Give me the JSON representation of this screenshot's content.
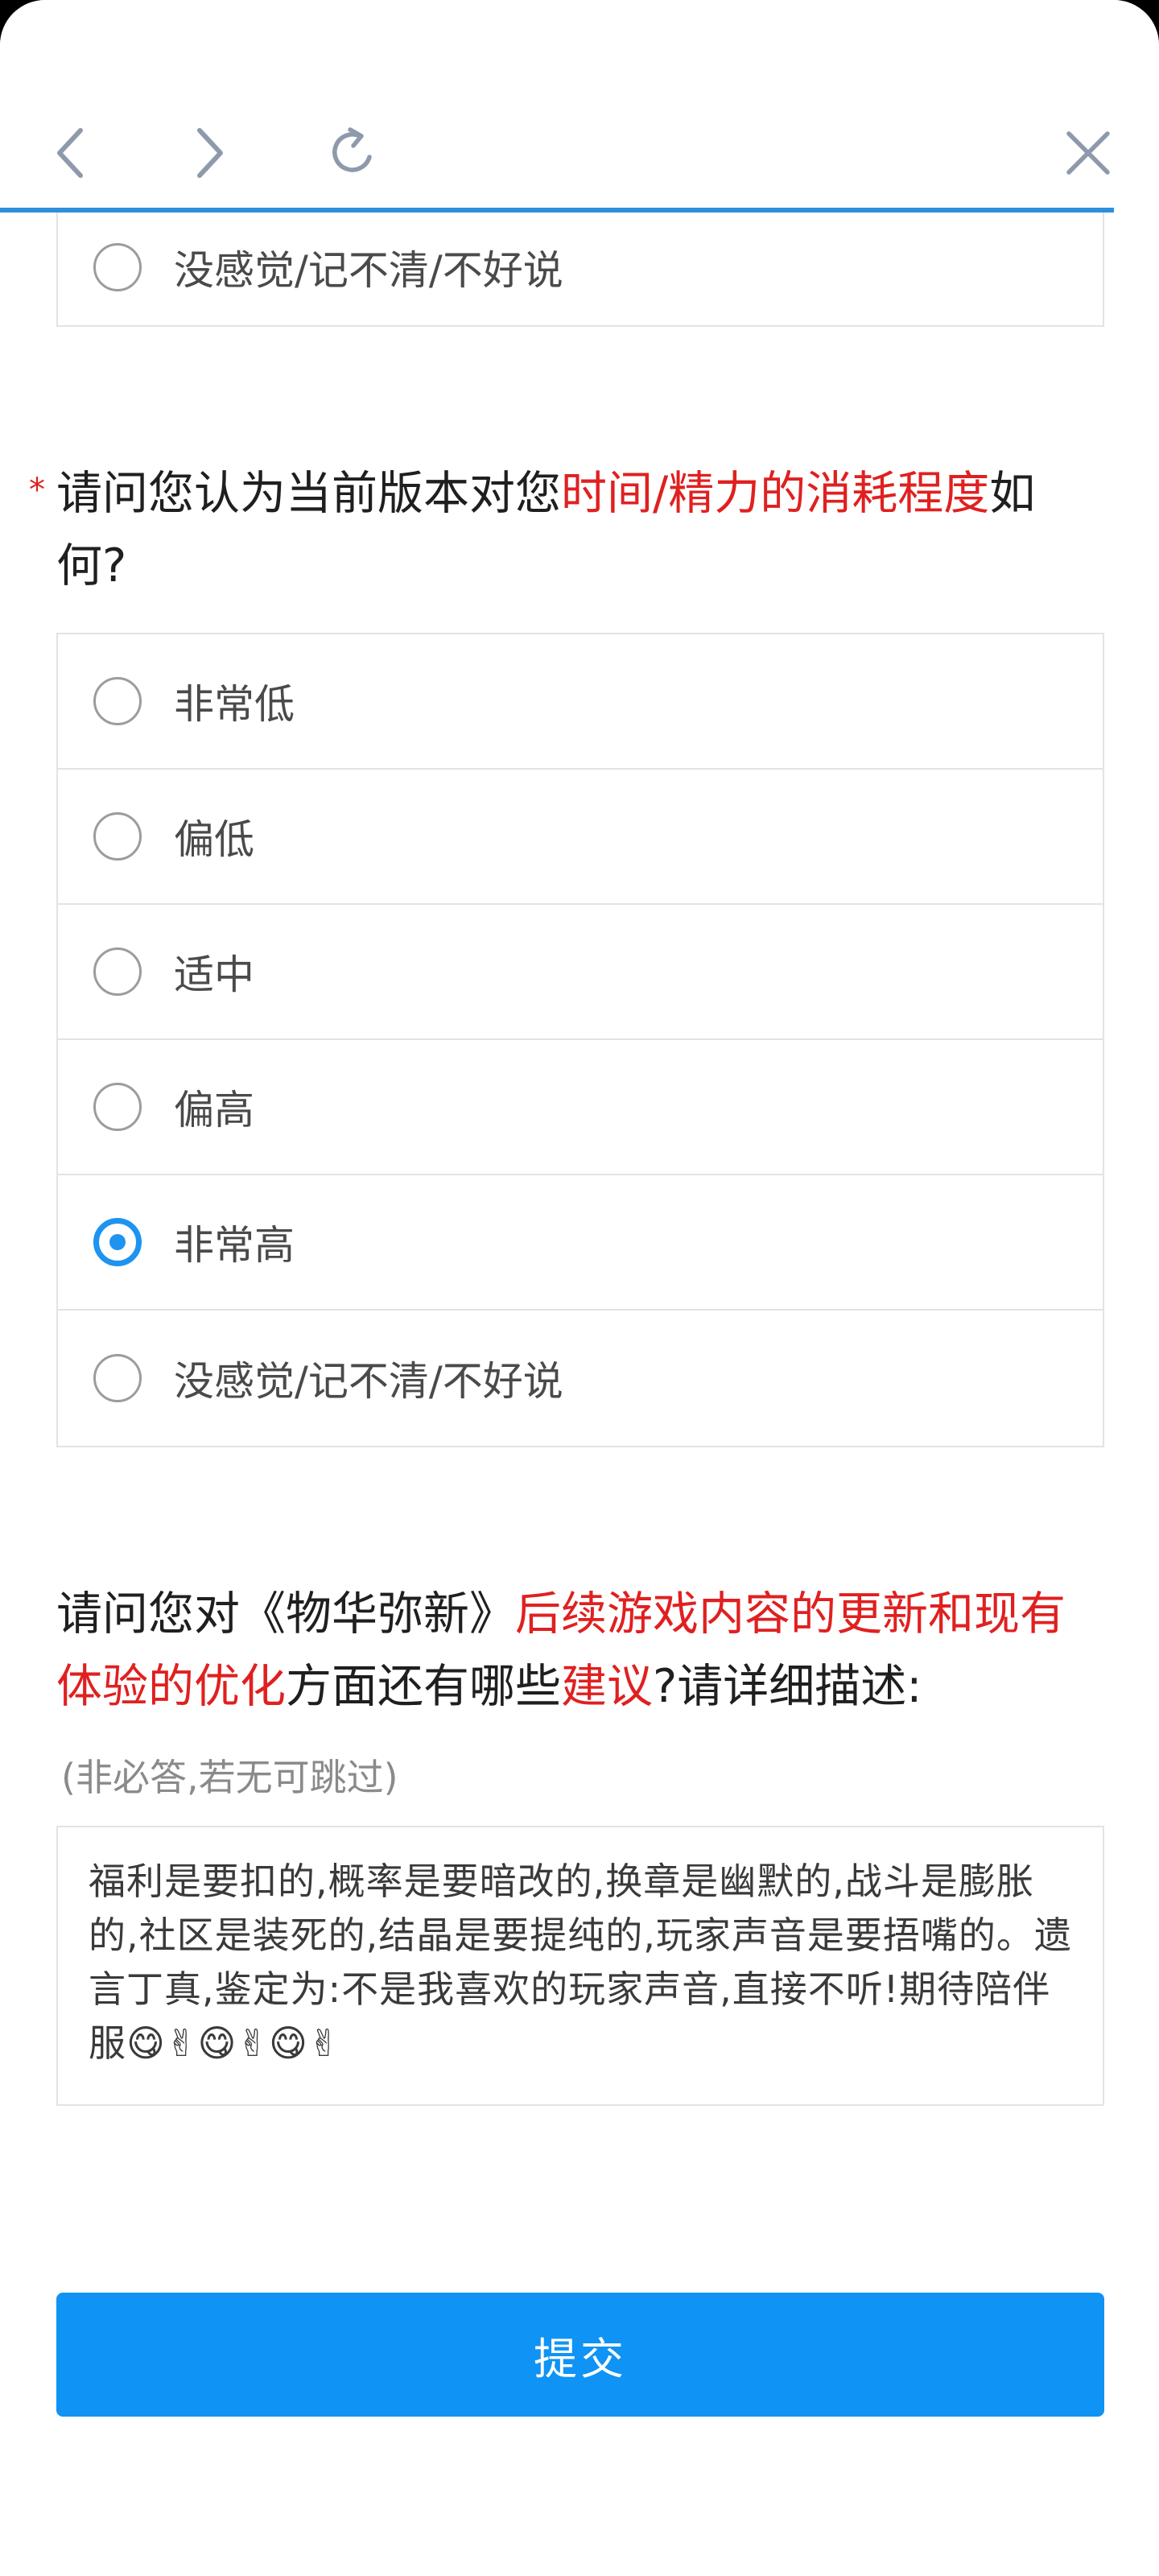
{
  "toolbar": {
    "back_icon": "chevron-left-icon",
    "forward_icon": "chevron-right-icon",
    "refresh_icon": "refresh-icon",
    "close_icon": "close-icon",
    "accent_color": "#2f8fdc"
  },
  "prev_question": {
    "last_option": "没感觉/记不清/不好说"
  },
  "q_time": {
    "required_mark": "*",
    "text_part1": "请问您认为当前版本对您",
    "text_highlight": "时间/精力的消耗程度",
    "text_part2": "如何?",
    "options": [
      {
        "label": "非常低",
        "checked": false
      },
      {
        "label": "偏低",
        "checked": false
      },
      {
        "label": "适中",
        "checked": false
      },
      {
        "label": "偏高",
        "checked": false
      },
      {
        "label": "非常高",
        "checked": true
      },
      {
        "label": "没感觉/记不清/不好说",
        "checked": false
      }
    ]
  },
  "q_suggest": {
    "text_part1": "请问您对《物华弥新》",
    "text_highlight1": "后续游戏内容的更新和现有体验的优化",
    "text_part2": "方面还有哪些",
    "text_highlight2": "建议",
    "text_part3": "?请详细描述:",
    "hint": "(非必答,若无可跳过)",
    "answer": "福利是要扣的,概率是要暗改的,换章是幽默的,战斗是膨胀的,社区是装死的,结晶是要提纯的,玩家声音是要捂嘴的。遗言丁真,鉴定为:不是我喜欢的玩家声音,直接不听!期待陪伴服😋✌😋✌😋✌"
  },
  "submit": {
    "label": "提交",
    "color": "#0f93f5"
  },
  "colors": {
    "highlight": "#e02020",
    "radio_checked": "#1e93f0"
  }
}
